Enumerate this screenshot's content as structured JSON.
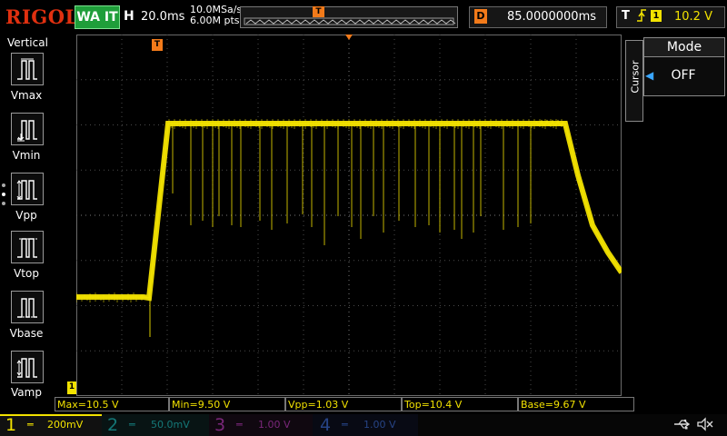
{
  "header": {
    "brand": "RIGOL",
    "run_status": "WA IT",
    "horizontal_label": "H",
    "timebase": "20.0ms",
    "sample_rate": "10.0MSa/s",
    "memory_depth": "6.00M pts",
    "trigger_marker": "T",
    "delay_label": "D",
    "delay_value": "85.0000000ms",
    "trigger_label": "T",
    "trigger_edge_icon": "rising-edge-icon",
    "trigger_source": "1",
    "trigger_level": "10.2 V"
  },
  "left_panel": {
    "title": "Vertical",
    "items": [
      {
        "label": "Vmax"
      },
      {
        "label": "Vmin"
      },
      {
        "label": "Vpp"
      },
      {
        "label": "Vtop"
      },
      {
        "label": "Vbase"
      },
      {
        "label": "Vamp"
      }
    ]
  },
  "right_panel": {
    "tab": "Cursor",
    "mode_label": "Mode",
    "mode_value": "OFF"
  },
  "markers": {
    "trigger_top": "T",
    "trigger_level": "T",
    "channel_offset": "1"
  },
  "measurements": [
    {
      "text": "Max=10.5 V"
    },
    {
      "text": "Min=9.50 V"
    },
    {
      "text": "Vpp=1.03 V"
    },
    {
      "text": "Top=10.4 V"
    },
    {
      "text": "Base=9.67 V"
    }
  ],
  "channels": [
    {
      "num": "1",
      "scale": "200mV",
      "active": true,
      "color": "#f2e200"
    },
    {
      "num": "2",
      "scale": "50.0mV",
      "active": false,
      "color": "#1ec8c8"
    },
    {
      "num": "3",
      "scale": "1.00 V",
      "active": false,
      "color": "#d040d0"
    },
    {
      "num": "4",
      "scale": "1.00 V",
      "active": false,
      "color": "#3a6ad0"
    }
  ],
  "colors": {
    "trace": "#f2e200",
    "accent_orange": "#f27a1a",
    "run_green": "#1f9e3a",
    "brand_red": "#e03010"
  },
  "status_icons": [
    "usb-icon",
    "mute-icon"
  ]
}
